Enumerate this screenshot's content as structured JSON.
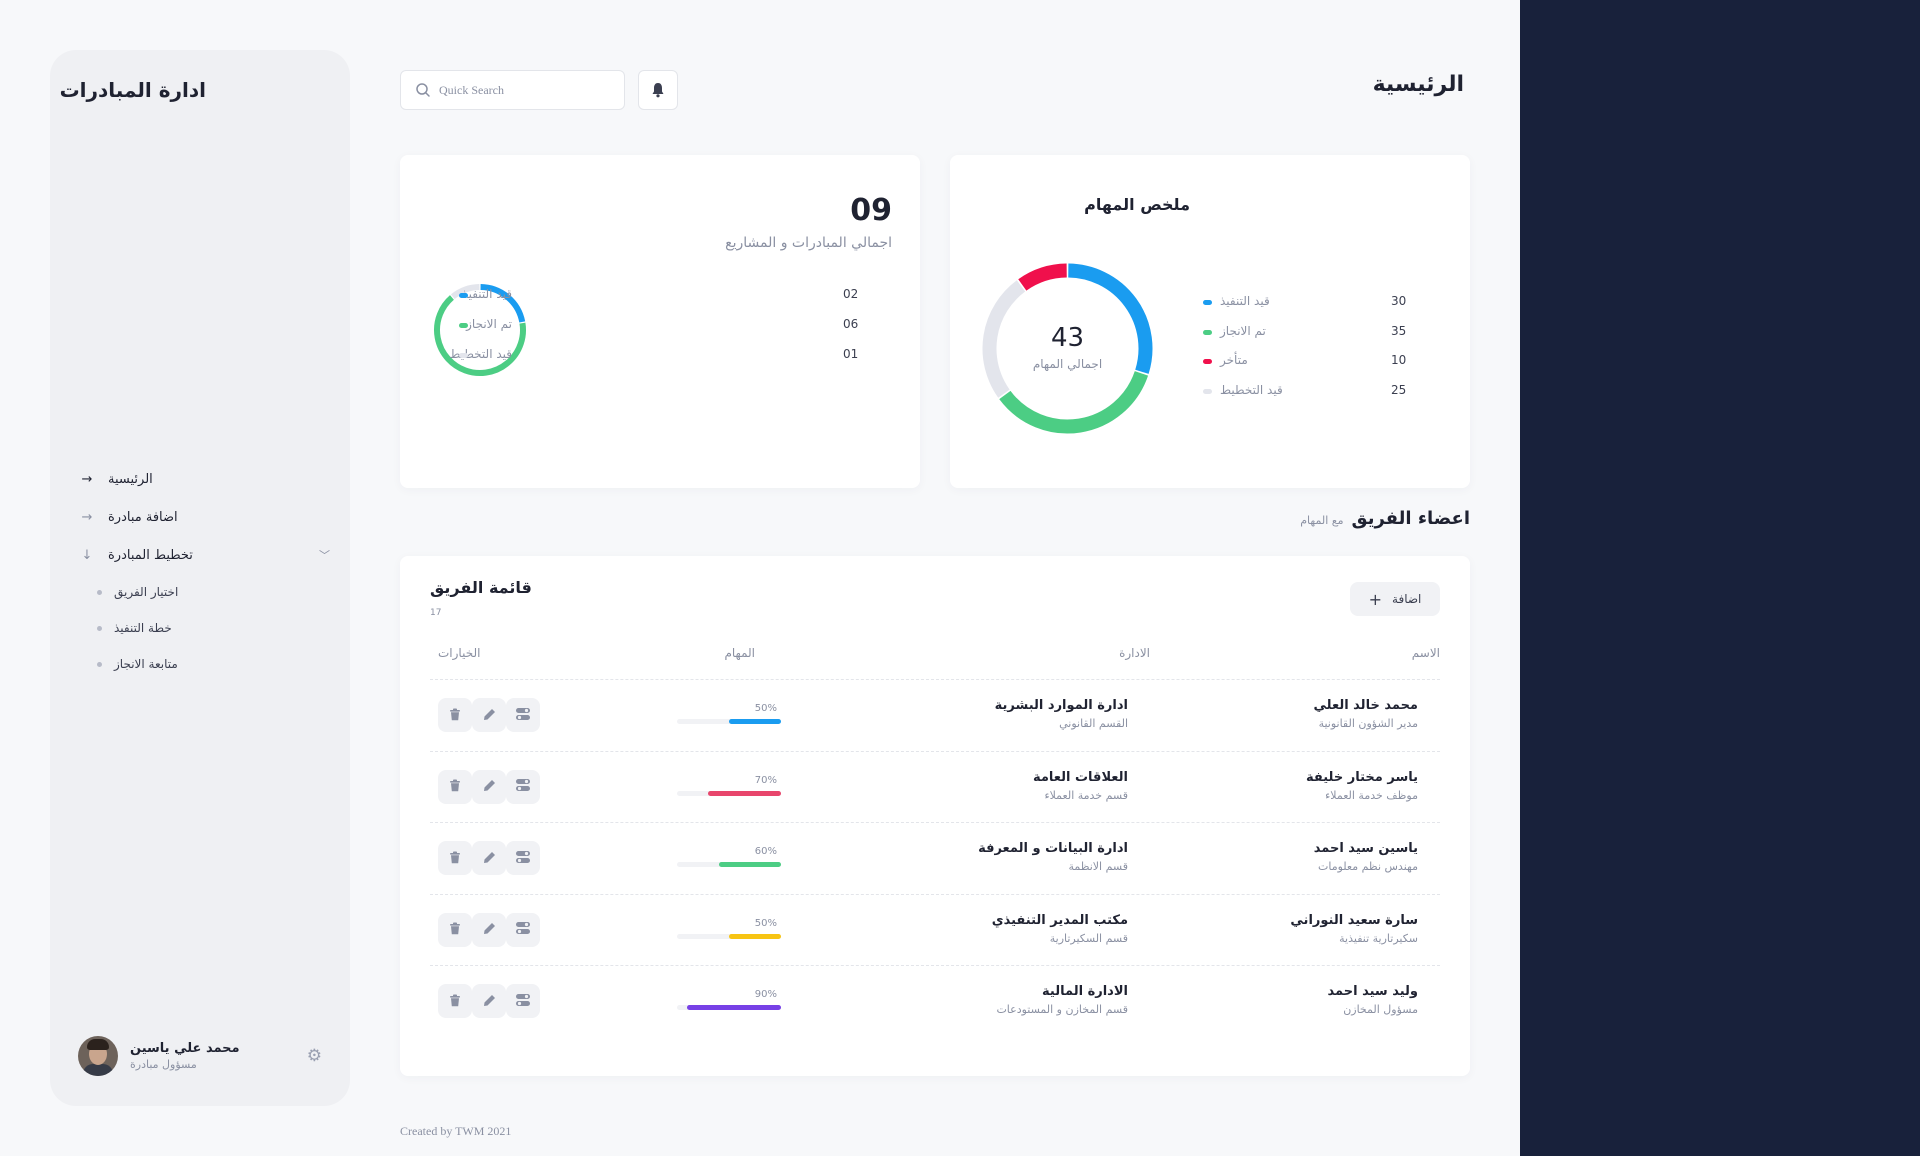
{
  "sidebar": {
    "brand": "ادارة المبادرات",
    "nav": [
      {
        "label": "الرئيسية"
      },
      {
        "label": "اضافة مبادرة"
      },
      {
        "label": "تخطيط المبادرة"
      }
    ],
    "subnav": [
      {
        "label": "اختيار الفريق"
      },
      {
        "label": "خطة التنفيذ"
      },
      {
        "label": "متابعة الانجاز"
      }
    ],
    "profile": {
      "name": "محمد علي ياسين",
      "role": "مسؤول مبادرة"
    }
  },
  "header": {
    "title": "الرئيسية",
    "search_placeholder": "Quick Search"
  },
  "initiatives": {
    "total": "09",
    "label": "اجمالي المبادرات و المشاريع",
    "legend": [
      {
        "label": "قيد التنفيذ",
        "value": "02",
        "color": "#1a9cf0"
      },
      {
        "label": "تم الانجاز",
        "value": "06",
        "color": "#4ccd84"
      },
      {
        "label": "قيد التخطيط",
        "value": "01",
        "color": "#e3e5ec"
      }
    ]
  },
  "tasks_summary": {
    "title": "ملخص المهام",
    "total": "43",
    "total_label": "اجمالي المهام",
    "legend": [
      {
        "label": "قيد التنفيذ",
        "value": "30",
        "color": "#1a9cf0"
      },
      {
        "label": "تم الانجاز",
        "value": "35",
        "color": "#4ccd84"
      },
      {
        "label": "متأخر",
        "value": "10",
        "color": "#f0104c"
      },
      {
        "label": "قيد التخطيط",
        "value": "25",
        "color": "#e3e5ec"
      }
    ]
  },
  "team_section": {
    "heading": "اعضاء الفريق",
    "sub": "مع المهام"
  },
  "team": {
    "title": "قائمة الفريق",
    "count": "17",
    "add_label": "اضافة",
    "columns": {
      "name": "الاسم",
      "dept": "الادارة",
      "tasks": "المهام",
      "options": "الخيارات"
    },
    "rows": [
      {
        "name": "محمد خالد العلي",
        "role": "مدير الشؤون القانونية",
        "dept": "ادارة الموارد البشرية",
        "unit": "القسم القانوني",
        "progress": "50%",
        "progress_value": 50,
        "color": "#1a9cf0"
      },
      {
        "name": "ياسر مختار خليفة",
        "role": "موظف خدمة العملاء",
        "dept": "العلاقات العامة",
        "unit": "قسم خدمة العملاء",
        "progress": "70%",
        "progress_value": 70,
        "color": "#e8466c"
      },
      {
        "name": "ياسين سيد احمد",
        "role": "مهندس نظم معلومات",
        "dept": "ادارة البيانات و المعرفة",
        "unit": "قسم الانظمة",
        "progress": "60%",
        "progress_value": 60,
        "color": "#4ccd84"
      },
      {
        "name": "سارة سعيد النوراني",
        "role": "سكيرتارية تنفيذية",
        "dept": "مكتب المدير التنفيذي",
        "unit": "قسم السكيرتارية",
        "progress": "50%",
        "progress_value": 50,
        "color": "#f7c413"
      },
      {
        "name": "وليد سيد احمد",
        "role": "مسؤول المخازن",
        "dept": "الادارة المالية",
        "unit": "قسم المخازن و المستودعات",
        "progress": "90%",
        "progress_value": 90,
        "color": "#7740e6"
      }
    ]
  },
  "footer": "Created by  TWM 2021"
}
